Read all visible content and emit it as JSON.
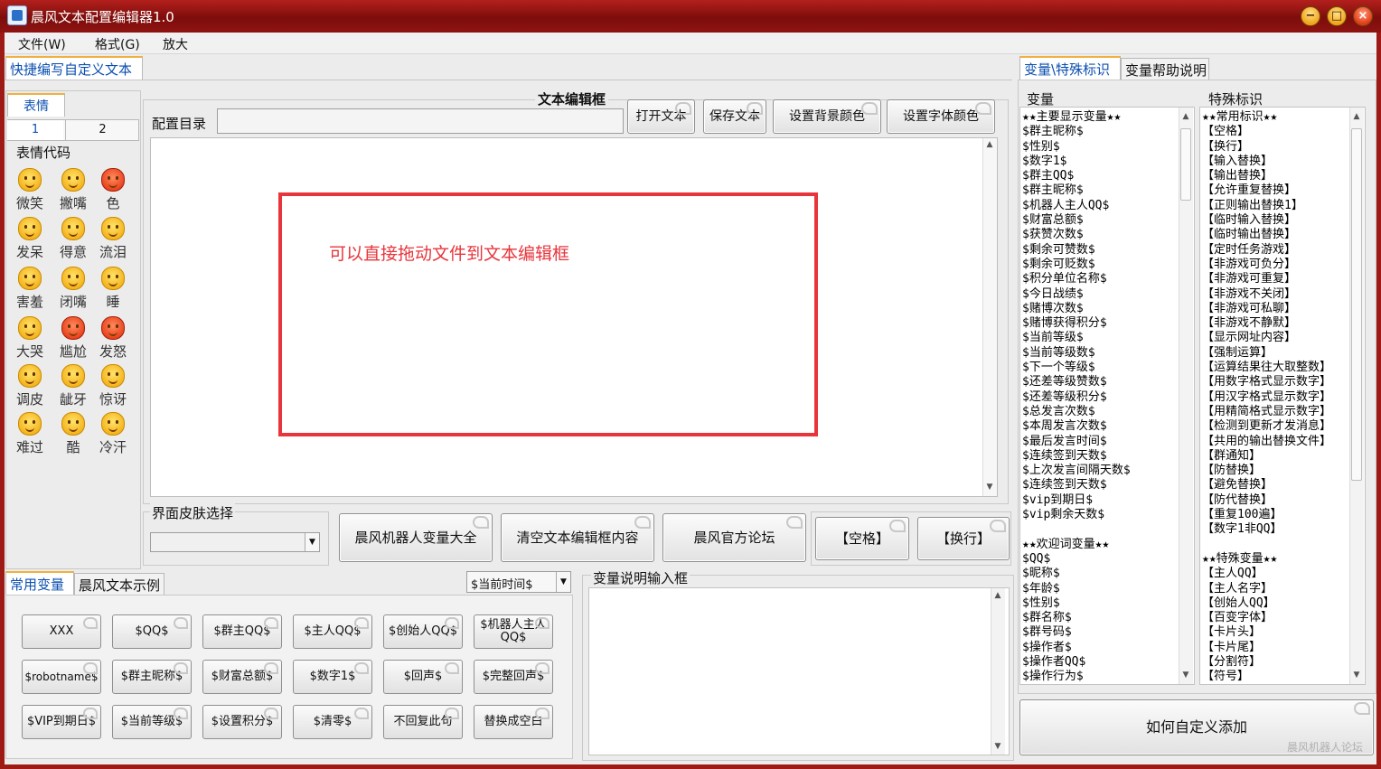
{
  "window": {
    "title": "晨风文本配置编辑器1.0",
    "minimize": "−",
    "maximize": "□",
    "close": "×"
  },
  "menu": [
    "文件(W)",
    "格式(G)",
    "放大"
  ],
  "left_top_tab": "快捷编写自定义文本",
  "emoji_tabs": {
    "main": "表情",
    "page1": "1",
    "page2": "2"
  },
  "emoji_section_title": "表情代码",
  "emojis": [
    "微笑",
    "撇嘴",
    "色",
    "发呆",
    "得意",
    "流泪",
    "害羞",
    "闭嘴",
    "睡",
    "大哭",
    "尴尬",
    "发怒",
    "调皮",
    "龇牙",
    "惊讶",
    "难过",
    "酷",
    "冷汗"
  ],
  "editor": {
    "title": "文本编辑框",
    "config_dir_label": "配置目录",
    "config_dir_value": "",
    "open_button": "打开文本",
    "save_button": "保存文本",
    "bg_color_button": "设置背景颜色",
    "font_color_button": "设置字体颜色",
    "hint_text": "可以直接拖动文件到文本编辑框"
  },
  "skin": {
    "label": "界面皮肤选择",
    "value": ""
  },
  "action_buttons": [
    "晨风机器人变量大全",
    "清空文本编辑框内容",
    "晨风官方论坛",
    "【空格】",
    "【换行】"
  ],
  "bottom_tabs": {
    "common": "常用变量",
    "examples": "晨风文本示例"
  },
  "time_select": "$当前时间$",
  "var_buttons": [
    "XXX",
    "$QQ$",
    "$群主QQ$",
    "$主人QQ$",
    "$创始人QQ$",
    "$机器人主人QQ$",
    "$robotname$",
    "$群主昵称$",
    "$财富总额$",
    "$数字1$",
    "$回声$",
    "$完整回声$",
    "$VIP到期日$",
    "$当前等级$",
    "$设置积分$",
    "$清零$",
    "不回复此句",
    "替换成空白"
  ],
  "var_desc_label": "变量说明输入框",
  "right_tabs": {
    "vars": "变量\\特殊标识",
    "help": "变量帮助说明"
  },
  "var_header": "变量",
  "special_header": "特殊标识",
  "variables": [
    "★★主要显示变量★★",
    "$群主昵称$",
    "$性别$",
    "$数字1$",
    "$群主QQ$",
    "$群主昵称$",
    "$机器人主人QQ$",
    "$财富总额$",
    "$获赞次数$",
    "$剩余可赞数$",
    "$剩余可贬数$",
    "$积分单位名称$",
    "$今日战绩$",
    "$赌博次数$",
    "$赌博获得积分$",
    "$当前等级$",
    "$当前等级数$",
    "$下一个等级$",
    "$还差等级赞数$",
    "$还差等级积分$",
    "$总发言次数$",
    "$本周发言次数$",
    "$最后发言时间$",
    "$连续签到天数$",
    "$上次发言间隔天数$",
    "$连续签到天数$",
    "$vip到期日$",
    "$vip剩余天数$",
    "",
    "★★欢迎词变量★★",
    "$QQ$",
    "$昵称$",
    "$年龄$",
    "$性别$",
    "$群名称$",
    "$群号码$",
    "$操作者$",
    "$操作者QQ$",
    "$操作行为$"
  ],
  "specials": [
    "★★常用标识★★",
    "【空格】",
    "【换行】",
    "【输入替换】",
    "【输出替换】",
    "【允许重复替换】",
    "【正则输出替换1】",
    "【临时输入替换】",
    "【临时输出替换】",
    "【定时任务游戏】",
    "【非游戏可负分】",
    "【非游戏可重复】",
    "【非游戏不关闭】",
    "【非游戏可私聊】",
    "【非游戏不静默】",
    "【显示网址内容】",
    "【强制运算】",
    "【运算结果往大取整数】",
    "【用数字格式显示数字】",
    "【用汉字格式显示数字】",
    "【用精简格式显示数字】",
    "【检测到更新才发消息】",
    "【共用的输出替换文件】",
    "【群通知】",
    "【防替换】",
    "【避免替换】",
    "【防代替换】",
    "【重复100遍】",
    "【数字1非QQ】",
    "",
    "★★特殊变量★★",
    "【主人QQ】",
    "【主人名字】",
    "【创始人QQ】",
    "【百变字体】",
    "【卡片头】",
    "【卡片尾】",
    "【分割符】",
    "【符号】"
  ],
  "how_to_button": "如何自定义添加",
  "watermark": "晨风机器人论坛",
  "colors": {
    "title_bar": "#9d1a15",
    "hint_border": "#e8353c",
    "hint_text": "#e8353c",
    "tab_active": "#0b4fb0"
  }
}
